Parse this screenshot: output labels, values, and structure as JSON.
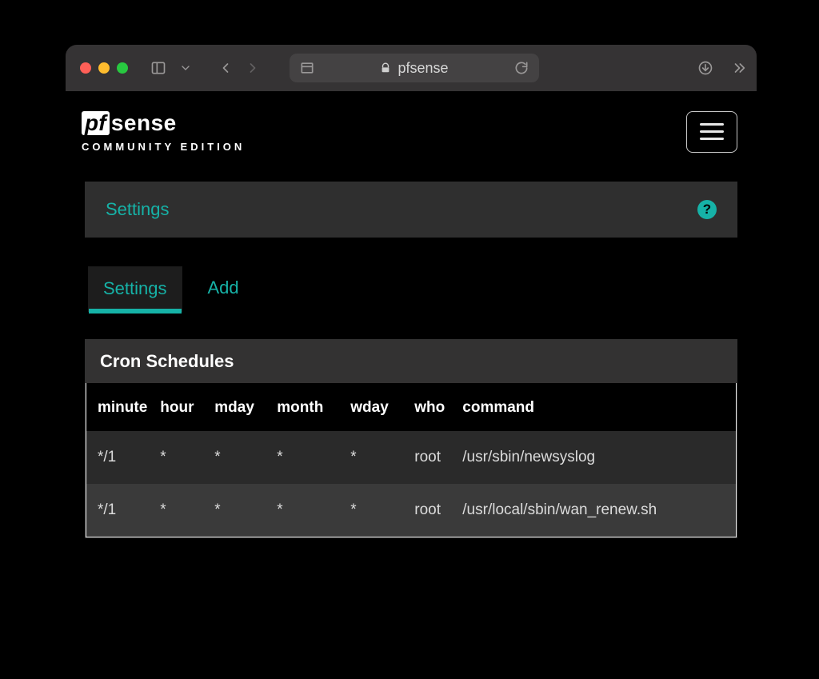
{
  "browser": {
    "site_label": "pfsense"
  },
  "brand": {
    "box": "pf",
    "word": "sense",
    "sub": "COMMUNITY EDITION"
  },
  "panel": {
    "settings_link": "Settings",
    "help_symbol": "?"
  },
  "tabs": {
    "settings": "Settings",
    "add": "Add"
  },
  "table": {
    "title": "Cron Schedules",
    "headers": {
      "minute": "minute",
      "hour": "hour",
      "mday": "mday",
      "month": "month",
      "wday": "wday",
      "who": "who",
      "command": "command"
    },
    "rows": [
      {
        "minute": "*/1",
        "hour": "*",
        "mday": "*",
        "month": "*",
        "wday": "*",
        "who": "root",
        "command": "/usr/sbin/newsyslog"
      },
      {
        "minute": "*/1",
        "hour": "*",
        "mday": "*",
        "month": "*",
        "wday": "*",
        "who": "root",
        "command": "/usr/local/sbin/wan_renew.sh"
      }
    ]
  }
}
